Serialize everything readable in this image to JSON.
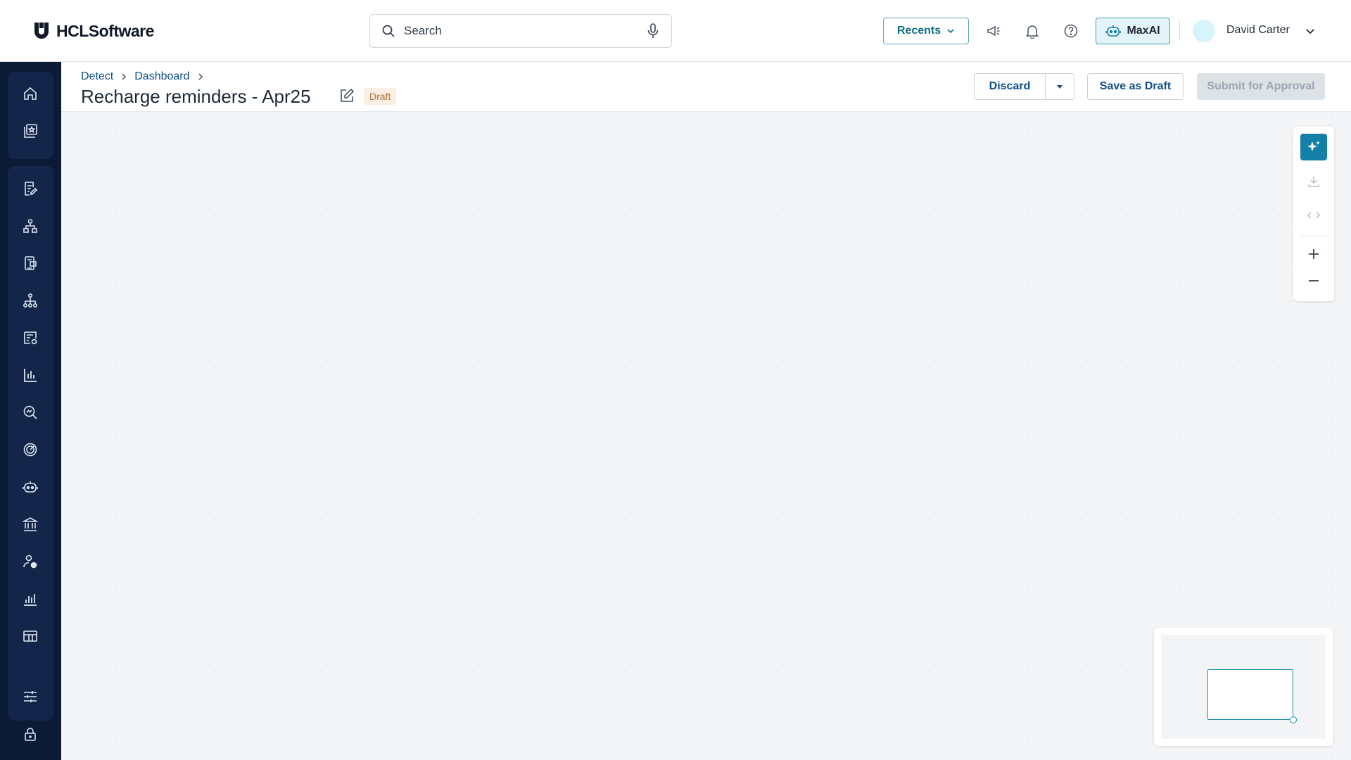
{
  "app": {
    "logo_text": "HCLSoftware"
  },
  "header": {
    "search_placeholder": "Search",
    "recents_label": "Recents",
    "maxai_label": "MaxAI",
    "user_name": "David Carter"
  },
  "sidebar": {
    "items": [
      {
        "icon": "home-icon"
      },
      {
        "icon": "star-document-icon"
      },
      {
        "icon": "edit-list-icon"
      },
      {
        "icon": "hierarchy-icon"
      },
      {
        "icon": "document-copy-icon"
      },
      {
        "icon": "org-tree-icon"
      },
      {
        "icon": "settings-list-icon"
      },
      {
        "icon": "bar-chart-icon"
      },
      {
        "icon": "search-analytics-icon"
      },
      {
        "icon": "target-icon"
      },
      {
        "icon": "robot-icon"
      },
      {
        "icon": "bank-icon"
      },
      {
        "icon": "user-settings-icon"
      },
      {
        "icon": "analytics-icon"
      },
      {
        "icon": "table-icon"
      },
      {
        "icon": "sliders-icon"
      },
      {
        "icon": "lock-icon"
      }
    ]
  },
  "page": {
    "breadcrumb": [
      "Detect",
      "Dashboard"
    ],
    "title": "Recharge reminders - Apr25",
    "status": "Draft",
    "actions": {
      "discard": "Discard",
      "save_draft": "Save as Draft",
      "submit": "Submit for Approval"
    }
  },
  "colors": {
    "sidebar_bg": "#0c1b35",
    "accent": "#1480a8",
    "link": "#0f4f88",
    "draft_badge_bg": "#fbeee2"
  }
}
